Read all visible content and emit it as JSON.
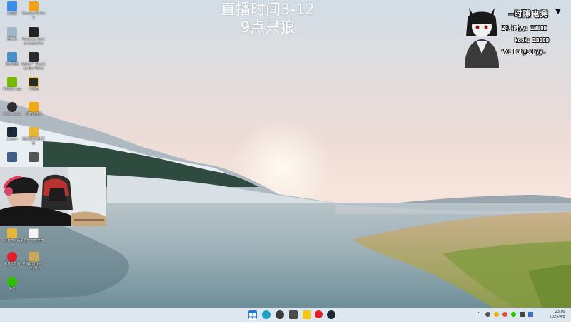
{
  "overlay": {
    "line1": "直播时间3-12",
    "line2": "9点只狼"
  },
  "card": {
    "brand": "时隙电竞",
    "row1": "24小时yy：13009",
    "row2": "kook：13009",
    "row3": "VX：BobyBobyy-"
  },
  "desktop_icons": [
    {
      "label": "此电脑",
      "icon": "computer-icon",
      "color": "#3a8ee6"
    },
    {
      "label": "Counter-Strike 2",
      "icon": "cs2-icon",
      "color": "#f0a21f"
    },
    {
      "label": "回收站",
      "icon": "recycle-bin-icon",
      "color": "#9fb7c8"
    },
    {
      "label": "Rockstar Games Launcher",
      "icon": "rockstar-icon",
      "color": "#222222"
    },
    {
      "label": "控制面板",
      "icon": "control-panel-icon",
      "color": "#4a90c8"
    },
    {
      "label": "Sekiro™ Shadows Die Twice",
      "icon": "sekiro-icon",
      "color": "#2b2b2b"
    },
    {
      "label": "NVIDIA App",
      "icon": "nvidia-icon",
      "color": "#76b900"
    },
    {
      "label": "YY语音",
      "icon": "yy-icon",
      "color": "#2a2a2a"
    },
    {
      "label": "OBS Studio",
      "icon": "obs-icon",
      "color": "#302e31"
    },
    {
      "label": "迅游加速器",
      "icon": "booster-icon",
      "color": "#f2a812"
    },
    {
      "label": "Steam",
      "icon": "steam-icon",
      "color": "#1b2838"
    },
    {
      "label": "完美世界竞技平台",
      "icon": "perfect-world-icon",
      "color": "#e7b73a"
    },
    {
      "label": "",
      "icon": "app-icon",
      "color": "#3d5f8a"
    },
    {
      "label": "",
      "icon": "app-icon",
      "color": "#555555"
    },
    {
      "label": "完美世界竞技平台",
      "icon": "perfect-world-icon",
      "color": "#e7b73a"
    },
    {
      "label": "新建 文本文档",
      "icon": "text-file-icon",
      "color": "#f4f4f4"
    },
    {
      "label": "网易云音乐",
      "icon": "netease-music-icon",
      "color": "#e11d2a"
    },
    {
      "label": "英雄联盟WeGame版",
      "icon": "lol-icon",
      "color": "#c8a858"
    },
    {
      "label": "微信",
      "icon": "wechat-icon",
      "color": "#2dc100"
    }
  ],
  "taskbar": {
    "apps": [
      {
        "name": "start-button",
        "color": "#1e7bd8"
      },
      {
        "name": "edge-icon",
        "color": "#1fa0c9"
      },
      {
        "name": "app-icon",
        "color": "#3b3b3b"
      },
      {
        "name": "app-icon",
        "color": "#4a4a4a"
      },
      {
        "name": "yy-icon",
        "color": "#f5c518"
      },
      {
        "name": "netease-music-icon",
        "color": "#e11d2a"
      },
      {
        "name": "steam-icon",
        "color": "#1b2838"
      }
    ],
    "time": "23:09",
    "date": "2025/4/8"
  }
}
